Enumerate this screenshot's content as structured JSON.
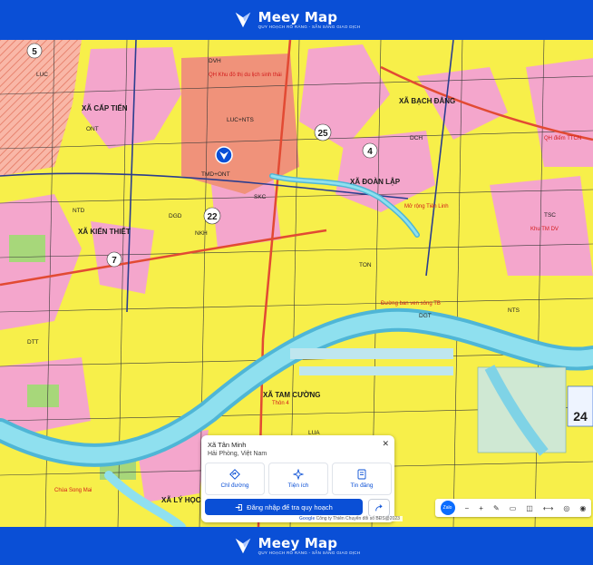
{
  "brand": {
    "name": "Meey Map",
    "tagline": "QUY HOẠCH RÕ RÀNG - SẴN SÀNG GIAO DỊCH",
    "color": "#0a4fd6"
  },
  "map": {
    "commune_labels": [
      "XÃ CẤP TIẾN",
      "XÃ BẠCH ĐẰNG",
      "XÃ ĐOÀN LẬP",
      "XÃ KIẾN THIẾT",
      "XÃ TAM CƯỜNG",
      "XÃ LÝ HỌC"
    ],
    "road_numbers": [
      "5",
      "25",
      "4",
      "22",
      "7",
      "24"
    ],
    "zone_codes": [
      "LUC",
      "ONT",
      "DVH",
      "NTS",
      "DTT",
      "TMD+ONT",
      "LUC+NTS",
      "SKC",
      "TON",
      "LUA",
      "DGD",
      "DCH",
      "NTD",
      "TSC",
      "NKH",
      "DGT"
    ],
    "annotations": [
      "Đường ban ven sông TB",
      "QH Khu đô thị du lịch sinh thái",
      "Chùa Song Mai",
      "Thôn 4",
      "Khu TM DV",
      "QH điểm TTCN",
      "Mở rộng Tiên Linh"
    ],
    "colors": {
      "land": "#f7ef4a",
      "residential": "#f6a2c9",
      "commercial": "#f38b7c",
      "water": "#7fd3e6",
      "farm_pink": "#f4c2dc"
    }
  },
  "info_panel": {
    "title": "Xã Tân Minh",
    "subtitle": "Hải Phòng, Việt Nam",
    "actions": [
      {
        "label": "Chỉ đường",
        "icon": "directions-icon"
      },
      {
        "label": "Tiện ích",
        "icon": "amenities-icon"
      },
      {
        "label": "Tin đăng",
        "icon": "listing-icon"
      }
    ],
    "login_label": "Đăng nhập để tra quy hoạch"
  },
  "attribution": {
    "google": "Google",
    "text": "Công ty Thiên Chuyển đổi số BĐS@2023"
  },
  "controls": {
    "zalo": "Zalo"
  }
}
